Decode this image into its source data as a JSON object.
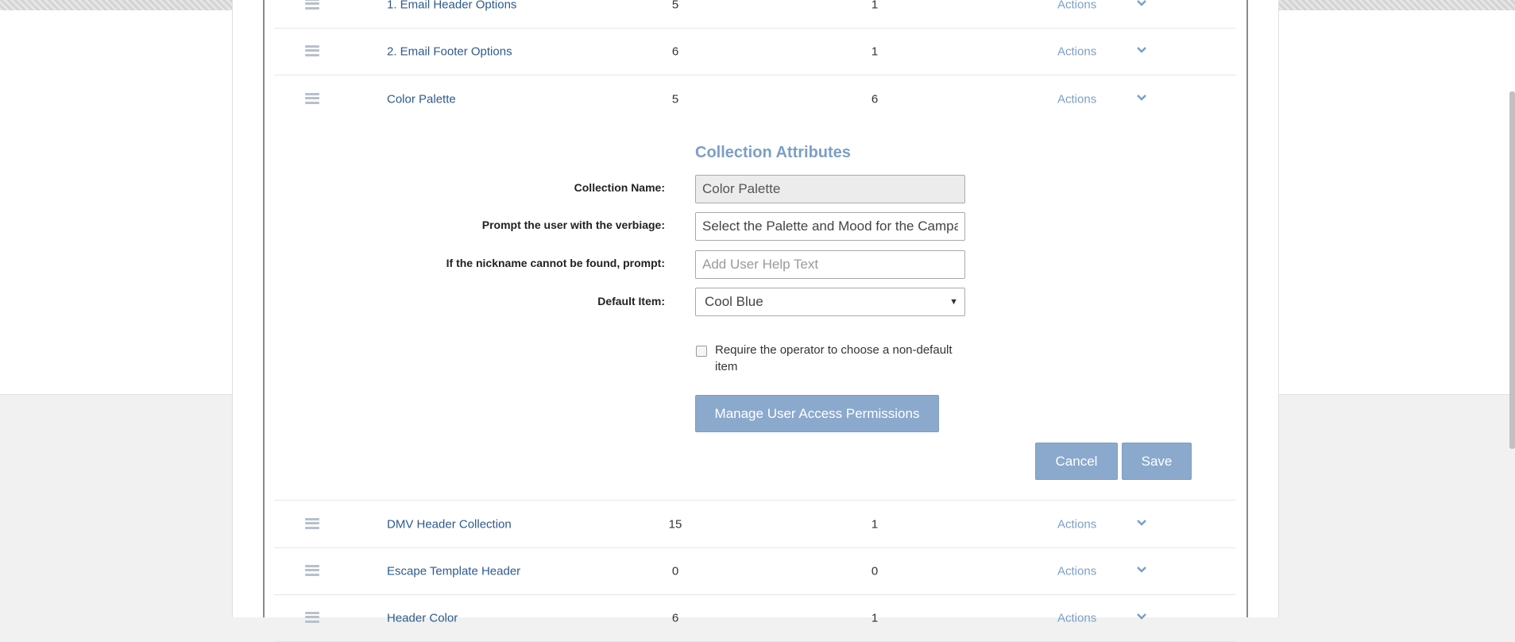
{
  "rows_top": [
    {
      "name": "1. Email Header Options",
      "c1": "5",
      "c2": "1",
      "actions": "Actions"
    },
    {
      "name": "2. Email Footer Options",
      "c1": "6",
      "c2": "1",
      "actions": "Actions"
    },
    {
      "name": "Color Palette",
      "c1": "5",
      "c2": "6",
      "actions": "Actions"
    }
  ],
  "rows_bottom": [
    {
      "name": "DMV Header Collection",
      "c1": "15",
      "c2": "1",
      "actions": "Actions"
    },
    {
      "name": "Escape Template Header",
      "c1": "0",
      "c2": "0",
      "actions": "Actions"
    },
    {
      "name": "Header Color",
      "c1": "6",
      "c2": "1",
      "actions": "Actions"
    }
  ],
  "form": {
    "title": "Collection Attributes",
    "collection_name_label": "Collection Name:",
    "collection_name_value": "Color Palette",
    "prompt_label": "Prompt the user with the verbiage:",
    "prompt_value": "Select the Palette and Mood for the Campaign",
    "nickname_label": "If the nickname cannot be found, prompt:",
    "nickname_placeholder": "Add User Help Text",
    "default_item_label": "Default Item:",
    "default_item_value": "Cool Blue",
    "require_label": "Require the operator to choose a non-default item",
    "require_checked": false,
    "manage_button": "Manage User Access Permissions",
    "cancel_button": "Cancel",
    "save_button": "Save"
  },
  "colors": {
    "link": "#2c5a8f",
    "actions": "#7b9fc6",
    "button": "#8aa9cc",
    "handle": "#b7c0cc"
  }
}
